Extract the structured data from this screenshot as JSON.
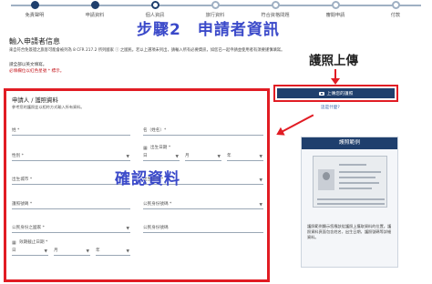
{
  "steps": [
    {
      "label": "免責聲明",
      "state": "done"
    },
    {
      "label": "申請資料",
      "state": "done"
    },
    {
      "label": "個人資訊",
      "state": "active"
    },
    {
      "label": "旅行資料",
      "state": "todo"
    },
    {
      "label": "符合資格問題",
      "state": "todo"
    },
    {
      "label": "審閱申請",
      "state": "todo"
    },
    {
      "label": "付款",
      "state": "todo"
    }
  ],
  "annotations": {
    "title": "步驟2　申請者資訊",
    "passport": "護照上傳",
    "confirm": "確認資料"
  },
  "heading": "輸入申請者信息",
  "intro": "來自符合免簽證之旅客可能會被列為 8 CFR 217.2 所列國家 ⓘ 之國民。若以上選項未列出，請輸入所有必要資訊，如您已一起申請並使用者有須要謹慎填寫。",
  "notice": {
    "line1": "請全部以英文填寫。",
    "line2": "必填欄位以紅色星號 * 標示。"
  },
  "form": {
    "title": "申請人 / 護照資料",
    "subtitle": "參考您的護照並以相符方式輸入所有資料。",
    "fields": {
      "surname": "姓 *",
      "given_name": "名（姓名）*",
      "dob_label": "出生日期 *",
      "dob_day": "日",
      "dob_month": "月",
      "dob_year": "年",
      "gender": "性別 *",
      "birth_city": "出生城市 *",
      "birth_country": "出生國家 *",
      "passport_no": "護照號碼 *",
      "national_id": "公民身份號碼 *",
      "passport_country": "公民身份之國家 *",
      "issue_country": "公民身份號碼",
      "expiry_label": "效期截止日期 *",
      "expiry_day": "日",
      "expiry_month": "月",
      "expiry_year": "年"
    }
  },
  "upload": {
    "button": "上傳您的護照",
    "help": "這是什麼?"
  },
  "example": {
    "title": "護照範例",
    "note": "護照範例顯示您應該從護照上獲取資料的位置。護照資料頁面包含姓名，出生日期，護照號碼等詳細資料。"
  },
  "colors": {
    "brand": "#1f3f6d",
    "highlight": "#e11c24",
    "annotation": "#3a49c9"
  }
}
